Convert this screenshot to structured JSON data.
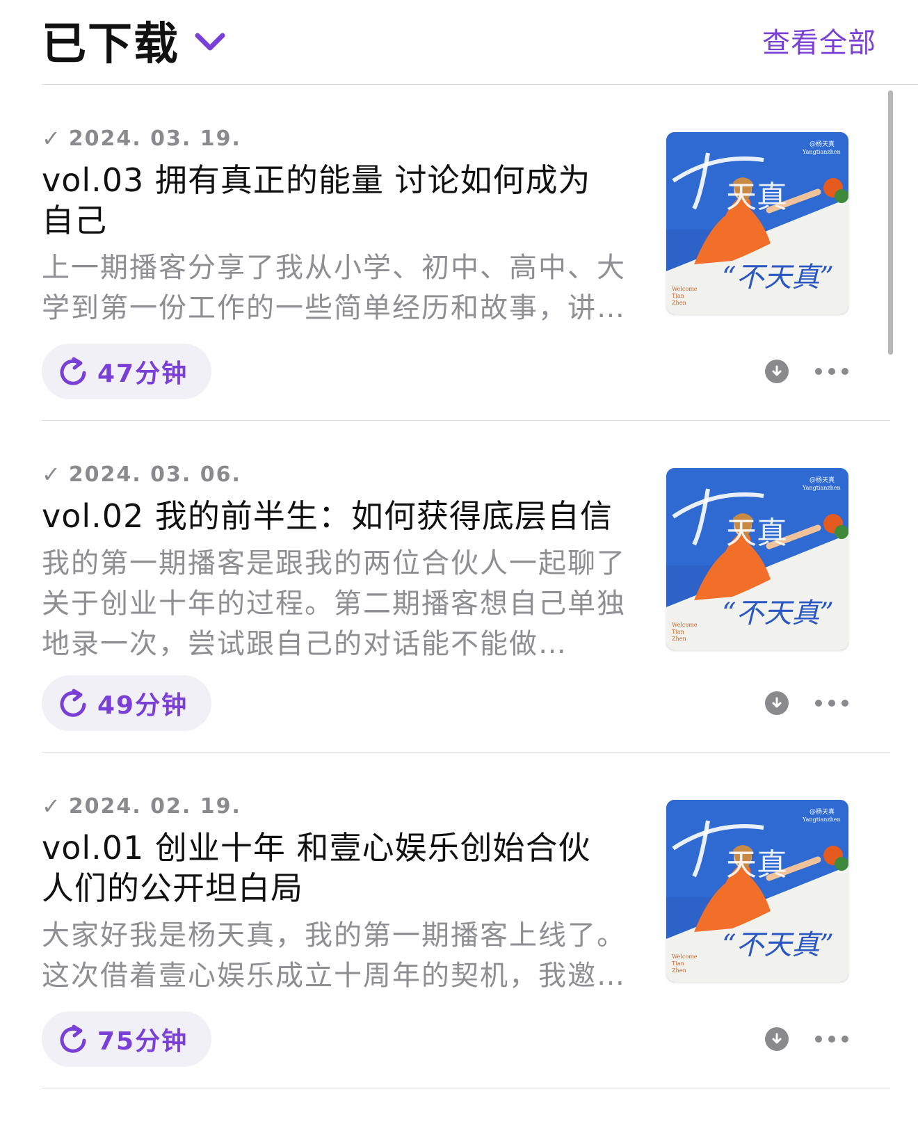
{
  "header": {
    "title": "已下载",
    "see_all": "查看全部"
  },
  "accent_color": "#7a3fd6",
  "episodes": [
    {
      "date": "2024. 03. 19.",
      "check": "✓",
      "title": "vol.03 拥有真正的能量 讨论如何成为自己",
      "description": "上一期播客分享了我从小学、初中、高中、大学到第一份工作的一些简单经历和故事，讲…",
      "duration": "47分钟"
    },
    {
      "date": "2024. 03. 06.",
      "check": "✓",
      "title": "vol.02 我的前半生：如何获得底层自信",
      "description": "我的第一期播客是跟我的两位合伙人一起聊了关于创业十年的过程。第二期播客想自己单独地录一次，尝试跟自己的对话能不能做…",
      "duration": "49分钟"
    },
    {
      "date": "2024. 02. 19.",
      "check": "✓",
      "title": "vol.01 创业十年 和壹心娱乐创始合伙人们的公开坦白局",
      "description": "大家好我是杨天真，我的第一期播客上线了。这次借着壹心娱乐成立十周年的契机，我邀…",
      "duration": "75分钟"
    }
  ],
  "artwork": {
    "top_right_text": "@杨天真",
    "top_right_sub": "Yangtianzhen",
    "bottom_left": [
      "Welcome",
      "Tian",
      "Zhen"
    ],
    "script_top": "天真",
    "script_bottom": "“不天真”"
  }
}
